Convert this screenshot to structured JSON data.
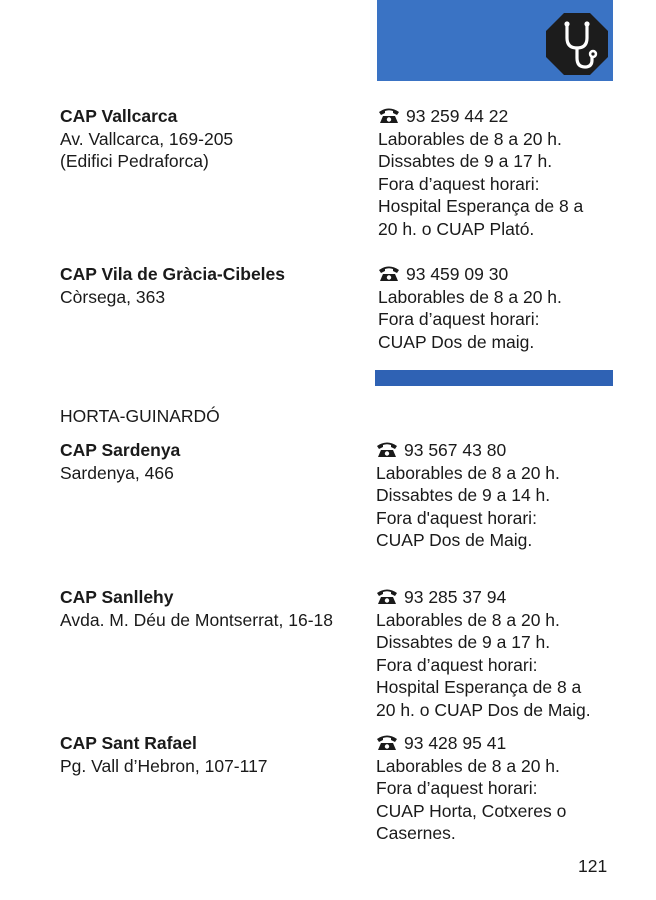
{
  "header": {
    "icon": "stethoscope-icon",
    "accent_color": "#3a73c4"
  },
  "entries_a": [
    {
      "name": "CAP Vallcarca",
      "address": [
        "Av. Vallcarca, 169-205",
        "(Edifici Pedraforca)"
      ],
      "phone": "93 259 44 22",
      "hours": [
        "Laborables de 8 a 20 h.",
        "Dissabtes de 9 a 17 h.",
        "Fora d’aquest horari:",
        "Hospital Esperança de 8 a",
        "20 h. o CUAP Plató."
      ]
    },
    {
      "name": "CAP Vila de Gràcia-Cibeles",
      "address": [
        "Còrsega, 363"
      ],
      "phone": "93 459 09 30",
      "hours": [
        "Laborables de 8 a 20 h.",
        "Fora d’aquest horari:",
        "CUAP Dos de maig."
      ]
    }
  ],
  "section": {
    "title": "HORTA-GUINARDÓ"
  },
  "entries_b": [
    {
      "name": "CAP Sardenya",
      "address": [
        "Sardenya, 466"
      ],
      "phone": "93 567 43 80",
      "hours": [
        "Laborables de 8 a 20 h.",
        "Dissabtes de 9 a 14 h.",
        "Fora d'aquest horari:",
        "CUAP Dos de Maig."
      ]
    },
    {
      "name": "CAP Sanllehy",
      "address": [
        "Avda. M. Déu de Montserrat, 16-18"
      ],
      "phone": "93 285 37 94",
      "hours": [
        "Laborables de 8 a 20 h.",
        "Dissabtes de 9 a 17 h.",
        "Fora d’aquest horari:",
        "Hospital Esperança de 8 a",
        "20 h. o CUAP Dos de Maig."
      ]
    },
    {
      "name": "CAP Sant Rafael",
      "address": [
        "Pg. Vall d’Hebron, 107-117"
      ],
      "phone": "93 428 95 41",
      "hours": [
        "Laborables de 8 a 20 h.",
        "Fora d’aquest horari:",
        "CUAP Horta, Cotxeres o",
        "Casernes."
      ]
    }
  ],
  "page_number": "121"
}
